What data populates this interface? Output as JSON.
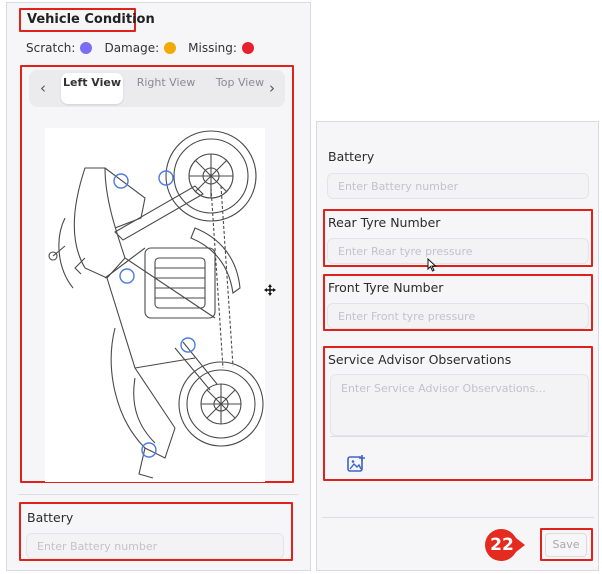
{
  "vehicle_condition": {
    "title": "Vehicle Condition",
    "legend": [
      {
        "label": "Scratch:",
        "color": "#7b6ef6"
      },
      {
        "label": "Damage:",
        "color": "#f2a900"
      },
      {
        "label": "Missing:",
        "color": "#e8202a"
      }
    ],
    "tabs": [
      {
        "label": "Left View",
        "active": true
      },
      {
        "label": "Right View",
        "active": false
      },
      {
        "label": "Top View",
        "active": false
      }
    ],
    "prev_icon": "chevron-left-icon",
    "next_icon": "chevron-right-icon"
  },
  "left_battery": {
    "label": "Battery",
    "placeholder": "Enter Battery number"
  },
  "right_form": {
    "battery": {
      "label": "Battery",
      "placeholder": "Enter Battery number"
    },
    "rear_tyre": {
      "label": "Rear Tyre Number",
      "placeholder": "Enter Rear tyre pressure"
    },
    "front_tyre": {
      "label": "Front Tyre Number",
      "placeholder": "Enter Front tyre pressure"
    },
    "observations": {
      "label": "Service Advisor Observations",
      "placeholder": "Enter Service Advisor Observations..."
    },
    "add_image_icon": "add-image-icon",
    "save_label": "Save"
  },
  "step_badge": {
    "number": "22",
    "color": "#e32b1f"
  },
  "accent_colors": {
    "annotation": "#e0221c",
    "marker": "#4a7be0"
  }
}
